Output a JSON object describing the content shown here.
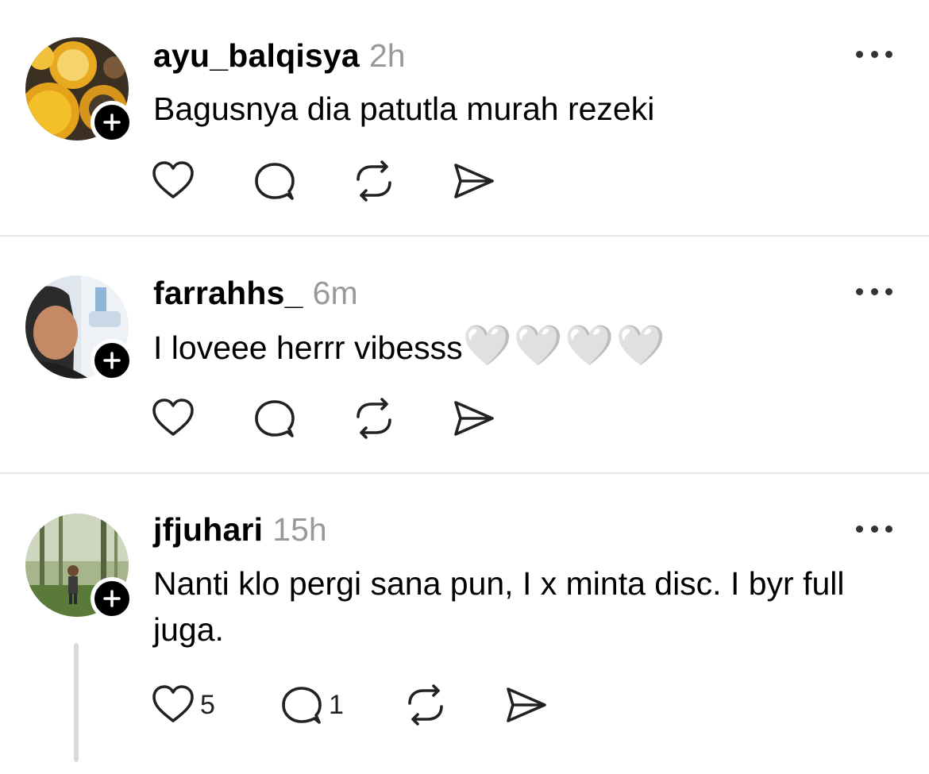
{
  "posts": [
    {
      "username": "ayu_balqisya",
      "time": "2h",
      "text": "Bagusnya dia patutla murah rezeki",
      "likes": "",
      "replies": ""
    },
    {
      "username": "farrahhs_",
      "time": "6m",
      "text": "I loveee herrr vibesss",
      "emoji": "🤍🤍🤍🤍",
      "likes": "",
      "replies": ""
    },
    {
      "username": "jfjuhari",
      "time": "15h",
      "text": "Nanti klo pergi sana pun, I x minta disc. I byr full juga.",
      "likes": "5",
      "replies": "1"
    }
  ],
  "icons": {
    "follow": "plus-icon",
    "more": "more-icon",
    "like": "heart-icon",
    "reply": "comment-icon",
    "repost": "repost-icon",
    "share": "share-icon"
  },
  "colors": {
    "text": "#000000",
    "muted": "#999999",
    "divider": "#e6e6e6",
    "icon": "#222222"
  }
}
